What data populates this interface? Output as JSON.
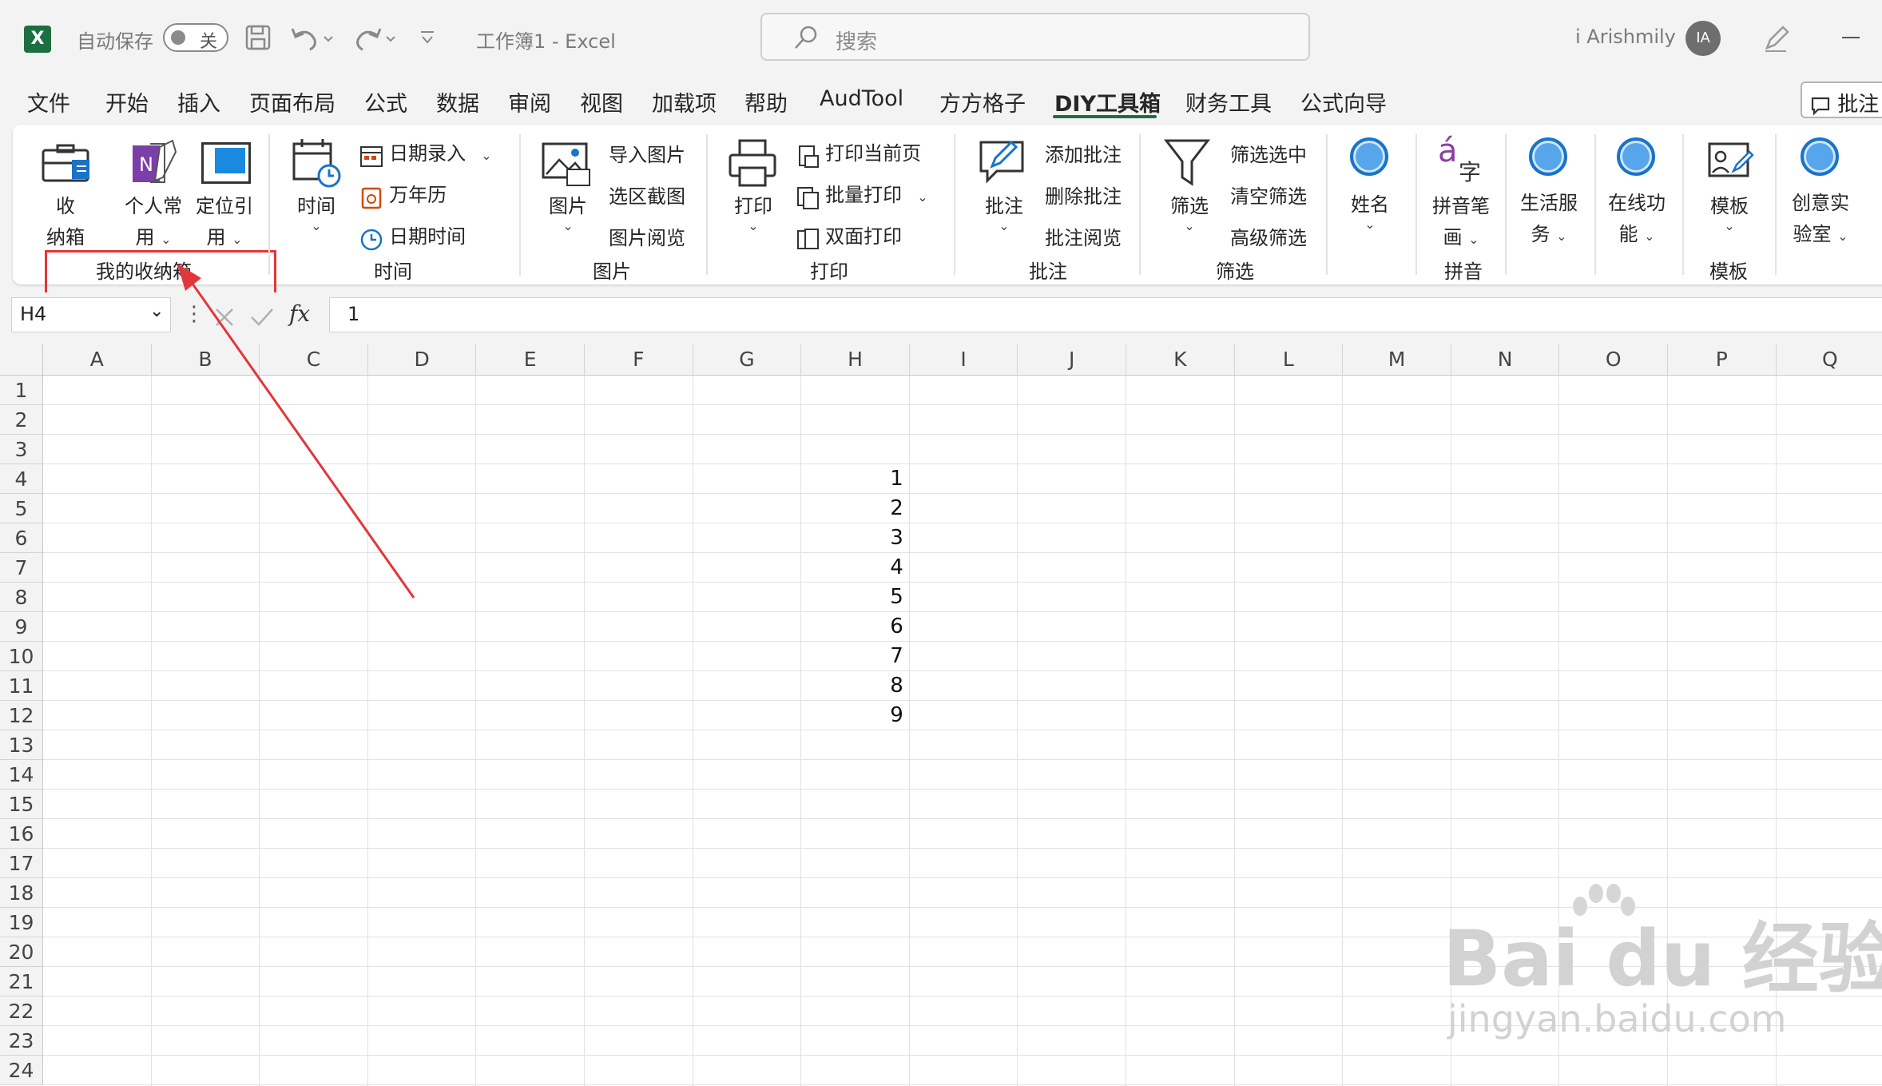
{
  "titlebar": {
    "autosave_label": "自动保存",
    "autosave_state": "关",
    "doc_title": "工作簿1  -  Excel",
    "search_placeholder": "搜索",
    "user_name": "i Arishmily",
    "avatar_initials": "IA"
  },
  "menu": [
    "文件",
    "开始",
    "插入",
    "页面布局",
    "公式",
    "数据",
    "审阅",
    "视图",
    "加载项",
    "帮助",
    "AudTool",
    "方方格子",
    "DIY工具箱",
    "财务工具",
    "公式向导"
  ],
  "menu_active": "DIY工具箱",
  "comment_button": "批注",
  "ribbon": {
    "storage": {
      "shoujia1": "收",
      "shoujia2": "纳箱",
      "geren1": "个人常",
      "geren2": "用",
      "dingwei1": "定位引",
      "dingwei2": "用",
      "group": "我的收纳箱"
    },
    "time": {
      "time_btn": "时间",
      "date_entry": "日期录入",
      "calendar": "万年历",
      "datetime": "日期时间",
      "group": "时间"
    },
    "picture": {
      "pic_btn": "图片",
      "import": "导入图片",
      "screenshot": "选区截图",
      "browse": "图片阅览",
      "group": "图片"
    },
    "print": {
      "print_btn": "打印",
      "current": "打印当前页",
      "batch": "批量打印",
      "duplex": "双面打印",
      "group": "打印"
    },
    "comment": {
      "comment_btn": "批注",
      "add": "添加批注",
      "delete": "删除批注",
      "browse": "批注阅览",
      "group": "批注"
    },
    "filter": {
      "filter_btn": "筛选",
      "selected": "筛选选中",
      "clear": "清空筛选",
      "advanced": "高级筛选",
      "group": "筛选"
    },
    "name_btn": "姓名",
    "pinyin": {
      "btn1": "拼音笔",
      "btn2": "画",
      "group": "拼音"
    },
    "life": {
      "l1": "生活服",
      "l2": "务"
    },
    "online": {
      "l1": "在线功",
      "l2": "能"
    },
    "template": {
      "btn": "模板",
      "group": "模板"
    },
    "lab": {
      "l1": "创意实",
      "l2": "验室"
    }
  },
  "formula_bar": {
    "name_box": "H4",
    "fx": "fx",
    "value": "1"
  },
  "columns": [
    "A",
    "B",
    "C",
    "D",
    "E",
    "F",
    "G",
    "H",
    "I",
    "J",
    "K",
    "L",
    "M",
    "N",
    "O",
    "P",
    "Q"
  ],
  "rows": [
    "1",
    "2",
    "3",
    "4",
    "5",
    "6",
    "7",
    "8",
    "9",
    "10",
    "11",
    "12",
    "13",
    "14",
    "15",
    "16",
    "17",
    "18",
    "19",
    "20",
    "21",
    "22",
    "23",
    "24"
  ],
  "cells_H": [
    "1",
    "2",
    "3",
    "4",
    "5",
    "6",
    "7",
    "8",
    "9"
  ],
  "watermark": {
    "brand": "Bai du 经验",
    "url": "jingyan.baidu.com"
  }
}
